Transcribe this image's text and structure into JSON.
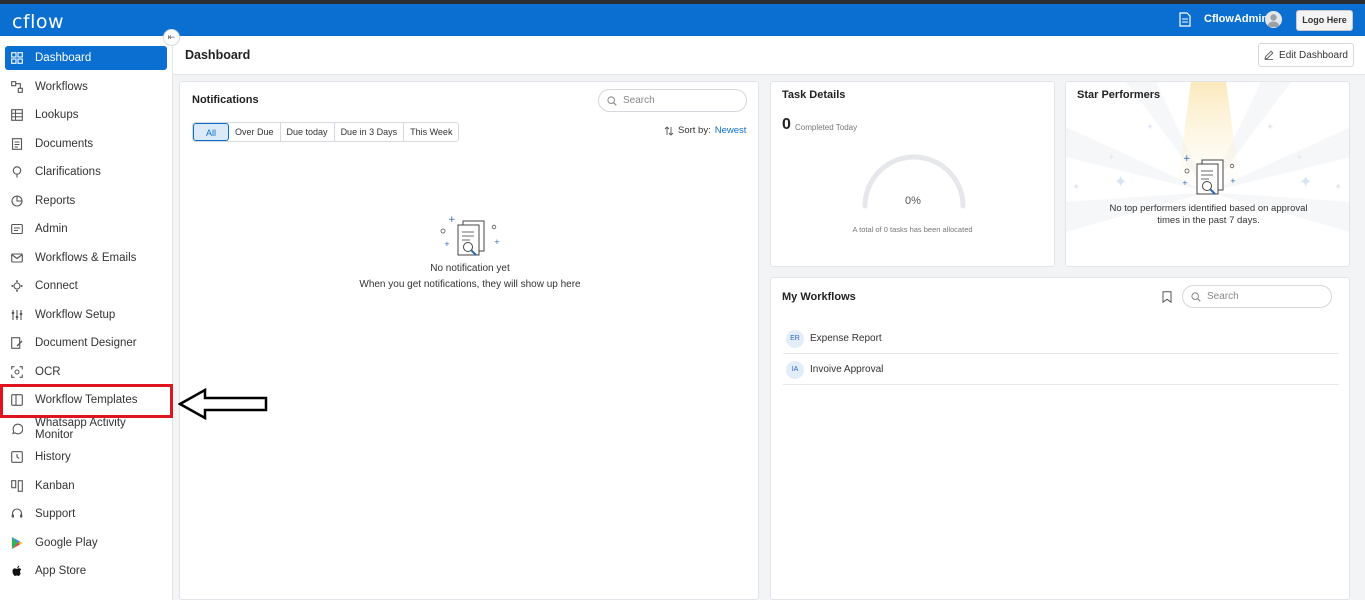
{
  "header": {
    "logo": "cflow",
    "username": "CflowAdmin",
    "logo_button": "Logo Here"
  },
  "sidebar": {
    "items": [
      {
        "label": "Dashboard",
        "icon": "dashboard-icon",
        "active": true
      },
      {
        "label": "Workflows",
        "icon": "workflows-icon"
      },
      {
        "label": "Lookups",
        "icon": "lookups-icon"
      },
      {
        "label": "Documents",
        "icon": "documents-icon"
      },
      {
        "label": "Clarifications",
        "icon": "clarifications-icon"
      },
      {
        "label": "Reports",
        "icon": "reports-icon"
      },
      {
        "label": "Admin",
        "icon": "admin-icon"
      },
      {
        "label": "Workflows & Emails",
        "icon": "mail-icon"
      },
      {
        "label": "Connect",
        "icon": "connect-icon"
      },
      {
        "label": "Workflow Setup",
        "icon": "sliders-icon"
      },
      {
        "label": "Document Designer",
        "icon": "edit-doc-icon"
      },
      {
        "label": "OCR",
        "icon": "ocr-icon"
      },
      {
        "label": "Workflow Templates",
        "icon": "template-icon",
        "highlighted": true
      },
      {
        "label": "Whatsapp Activity Monitor",
        "icon": "whatsapp-icon"
      },
      {
        "label": "History",
        "icon": "history-icon"
      },
      {
        "label": "Kanban",
        "icon": "kanban-icon"
      },
      {
        "label": "Support",
        "icon": "headset-icon"
      },
      {
        "label": "Google Play",
        "icon": "google-play-icon"
      },
      {
        "label": "App Store",
        "icon": "apple-icon"
      }
    ]
  },
  "main": {
    "title": "Dashboard",
    "edit_button": "Edit Dashboard"
  },
  "notifications": {
    "title": "Notifications",
    "search_placeholder": "Search",
    "filters": [
      "All",
      "Over Due",
      "Due today",
      "Due in 3 Days",
      "This Week"
    ],
    "active_filter": "All",
    "sort_label": "Sort by:",
    "sort_value": "Newest",
    "empty_title": "No notification yet",
    "empty_message": "When you get notifications, they will show up here"
  },
  "task_details": {
    "title": "Task Details",
    "completed_count": "0",
    "completed_label": "Completed Today",
    "percent": "0%",
    "progress_fraction": 0,
    "footer": "A total of 0 tasks has been allocated"
  },
  "star_performers": {
    "title": "Star Performers",
    "empty_message": "No top performers identified based on approval times in the past 7 days."
  },
  "my_workflows": {
    "title": "My Workflows",
    "search_placeholder": "Search",
    "items": [
      {
        "initials": "ER",
        "name": "Expense Report"
      },
      {
        "initials": "IA",
        "name": "Invoive Approval"
      }
    ]
  },
  "colors": {
    "brand": "#0a6fd1",
    "highlight": "#e0141e"
  }
}
